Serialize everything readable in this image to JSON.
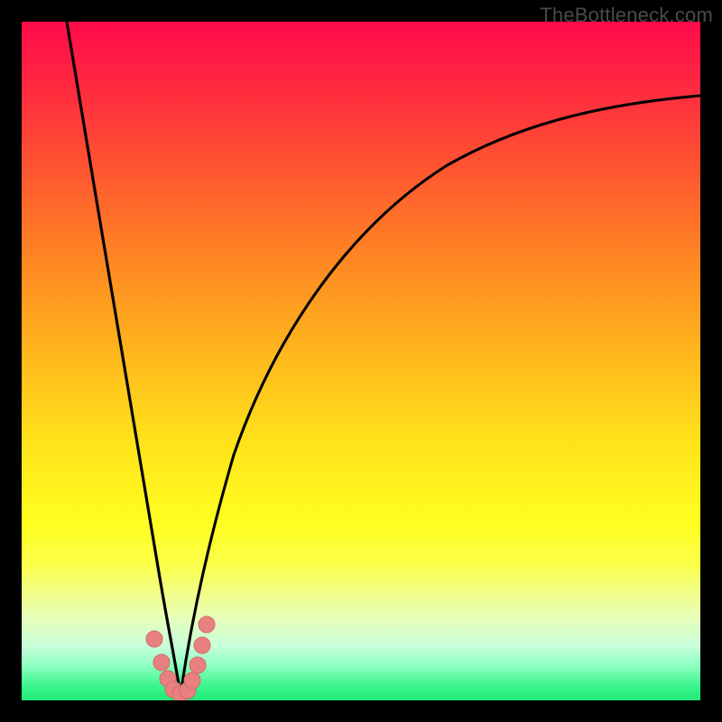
{
  "watermark": {
    "text": "TheBottleneck.com"
  },
  "colors": {
    "curve_stroke": "#000000",
    "dot_fill": "#e98080",
    "dot_stroke": "#d46a6a"
  },
  "chart_data": {
    "type": "line",
    "title": "",
    "xlabel": "",
    "ylabel": "",
    "xlim": [
      0,
      100
    ],
    "ylim": [
      0,
      100
    ],
    "note": "axes unlabeled; values estimated from plot area position (0,0 bottom-left, 100,100 top-right)",
    "series": [
      {
        "name": "left-curve",
        "x": [
          6.6,
          9,
          12,
          15,
          18,
          20,
          22,
          23.4
        ],
        "y": [
          100,
          78,
          55,
          34,
          17,
          8,
          3,
          0
        ]
      },
      {
        "name": "right-curve",
        "x": [
          23.4,
          25,
          28,
          33,
          40,
          50,
          62,
          75,
          88,
          100
        ],
        "y": [
          0,
          8,
          22,
          39,
          54,
          67,
          77,
          83,
          87,
          89
        ]
      }
    ],
    "dots": {
      "name": "dip-markers",
      "points": [
        {
          "x": 19.5,
          "y": 9.0
        },
        {
          "x": 20.6,
          "y": 5.5
        },
        {
          "x": 21.5,
          "y": 3.0
        },
        {
          "x": 22.3,
          "y": 1.5
        },
        {
          "x": 23.4,
          "y": 0.8
        },
        {
          "x": 24.4,
          "y": 1.3
        },
        {
          "x": 25.1,
          "y": 2.8
        },
        {
          "x": 25.9,
          "y": 5.0
        },
        {
          "x": 26.6,
          "y": 8.0
        },
        {
          "x": 27.2,
          "y": 11.0
        }
      ]
    }
  }
}
